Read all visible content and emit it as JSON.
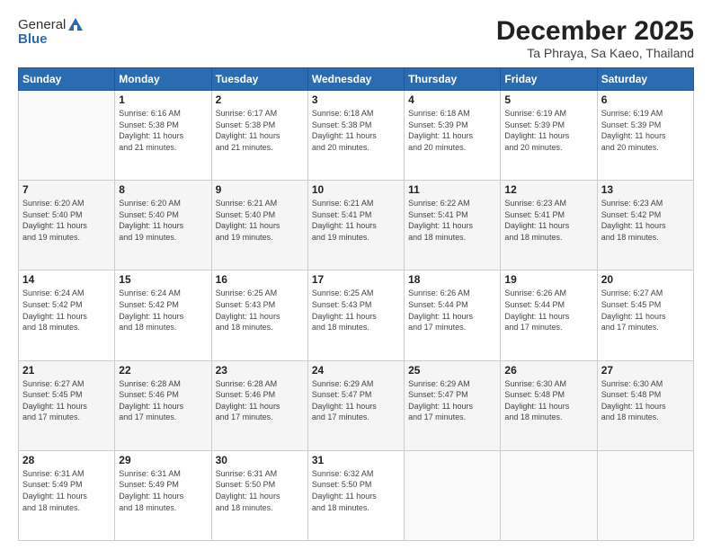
{
  "header": {
    "logo_general": "General",
    "logo_blue": "Blue",
    "month_title": "December 2025",
    "location": "Ta Phraya, Sa Kaeo, Thailand"
  },
  "weekdays": [
    "Sunday",
    "Monday",
    "Tuesday",
    "Wednesday",
    "Thursday",
    "Friday",
    "Saturday"
  ],
  "weeks": [
    [
      {
        "date": "",
        "sunrise": "",
        "sunset": "",
        "daylight": ""
      },
      {
        "date": "1",
        "sunrise": "Sunrise: 6:16 AM",
        "sunset": "Sunset: 5:38 PM",
        "daylight": "Daylight: 11 hours and 21 minutes."
      },
      {
        "date": "2",
        "sunrise": "Sunrise: 6:17 AM",
        "sunset": "Sunset: 5:38 PM",
        "daylight": "Daylight: 11 hours and 21 minutes."
      },
      {
        "date": "3",
        "sunrise": "Sunrise: 6:18 AM",
        "sunset": "Sunset: 5:38 PM",
        "daylight": "Daylight: 11 hours and 20 minutes."
      },
      {
        "date": "4",
        "sunrise": "Sunrise: 6:18 AM",
        "sunset": "Sunset: 5:39 PM",
        "daylight": "Daylight: 11 hours and 20 minutes."
      },
      {
        "date": "5",
        "sunrise": "Sunrise: 6:19 AM",
        "sunset": "Sunset: 5:39 PM",
        "daylight": "Daylight: 11 hours and 20 minutes."
      },
      {
        "date": "6",
        "sunrise": "Sunrise: 6:19 AM",
        "sunset": "Sunset: 5:39 PM",
        "daylight": "Daylight: 11 hours and 20 minutes."
      }
    ],
    [
      {
        "date": "7",
        "sunrise": "Sunrise: 6:20 AM",
        "sunset": "Sunset: 5:40 PM",
        "daylight": "Daylight: 11 hours and 19 minutes."
      },
      {
        "date": "8",
        "sunrise": "Sunrise: 6:20 AM",
        "sunset": "Sunset: 5:40 PM",
        "daylight": "Daylight: 11 hours and 19 minutes."
      },
      {
        "date": "9",
        "sunrise": "Sunrise: 6:21 AM",
        "sunset": "Sunset: 5:40 PM",
        "daylight": "Daylight: 11 hours and 19 minutes."
      },
      {
        "date": "10",
        "sunrise": "Sunrise: 6:21 AM",
        "sunset": "Sunset: 5:41 PM",
        "daylight": "Daylight: 11 hours and 19 minutes."
      },
      {
        "date": "11",
        "sunrise": "Sunrise: 6:22 AM",
        "sunset": "Sunset: 5:41 PM",
        "daylight": "Daylight: 11 hours and 18 minutes."
      },
      {
        "date": "12",
        "sunrise": "Sunrise: 6:23 AM",
        "sunset": "Sunset: 5:41 PM",
        "daylight": "Daylight: 11 hours and 18 minutes."
      },
      {
        "date": "13",
        "sunrise": "Sunrise: 6:23 AM",
        "sunset": "Sunset: 5:42 PM",
        "daylight": "Daylight: 11 hours and 18 minutes."
      }
    ],
    [
      {
        "date": "14",
        "sunrise": "Sunrise: 6:24 AM",
        "sunset": "Sunset: 5:42 PM",
        "daylight": "Daylight: 11 hours and 18 minutes."
      },
      {
        "date": "15",
        "sunrise": "Sunrise: 6:24 AM",
        "sunset": "Sunset: 5:42 PM",
        "daylight": "Daylight: 11 hours and 18 minutes."
      },
      {
        "date": "16",
        "sunrise": "Sunrise: 6:25 AM",
        "sunset": "Sunset: 5:43 PM",
        "daylight": "Daylight: 11 hours and 18 minutes."
      },
      {
        "date": "17",
        "sunrise": "Sunrise: 6:25 AM",
        "sunset": "Sunset: 5:43 PM",
        "daylight": "Daylight: 11 hours and 18 minutes."
      },
      {
        "date": "18",
        "sunrise": "Sunrise: 6:26 AM",
        "sunset": "Sunset: 5:44 PM",
        "daylight": "Daylight: 11 hours and 17 minutes."
      },
      {
        "date": "19",
        "sunrise": "Sunrise: 6:26 AM",
        "sunset": "Sunset: 5:44 PM",
        "daylight": "Daylight: 11 hours and 17 minutes."
      },
      {
        "date": "20",
        "sunrise": "Sunrise: 6:27 AM",
        "sunset": "Sunset: 5:45 PM",
        "daylight": "Daylight: 11 hours and 17 minutes."
      }
    ],
    [
      {
        "date": "21",
        "sunrise": "Sunrise: 6:27 AM",
        "sunset": "Sunset: 5:45 PM",
        "daylight": "Daylight: 11 hours and 17 minutes."
      },
      {
        "date": "22",
        "sunrise": "Sunrise: 6:28 AM",
        "sunset": "Sunset: 5:46 PM",
        "daylight": "Daylight: 11 hours and 17 minutes."
      },
      {
        "date": "23",
        "sunrise": "Sunrise: 6:28 AM",
        "sunset": "Sunset: 5:46 PM",
        "daylight": "Daylight: 11 hours and 17 minutes."
      },
      {
        "date": "24",
        "sunrise": "Sunrise: 6:29 AM",
        "sunset": "Sunset: 5:47 PM",
        "daylight": "Daylight: 11 hours and 17 minutes."
      },
      {
        "date": "25",
        "sunrise": "Sunrise: 6:29 AM",
        "sunset": "Sunset: 5:47 PM",
        "daylight": "Daylight: 11 hours and 17 minutes."
      },
      {
        "date": "26",
        "sunrise": "Sunrise: 6:30 AM",
        "sunset": "Sunset: 5:48 PM",
        "daylight": "Daylight: 11 hours and 18 minutes."
      },
      {
        "date": "27",
        "sunrise": "Sunrise: 6:30 AM",
        "sunset": "Sunset: 5:48 PM",
        "daylight": "Daylight: 11 hours and 18 minutes."
      }
    ],
    [
      {
        "date": "28",
        "sunrise": "Sunrise: 6:31 AM",
        "sunset": "Sunset: 5:49 PM",
        "daylight": "Daylight: 11 hours and 18 minutes."
      },
      {
        "date": "29",
        "sunrise": "Sunrise: 6:31 AM",
        "sunset": "Sunset: 5:49 PM",
        "daylight": "Daylight: 11 hours and 18 minutes."
      },
      {
        "date": "30",
        "sunrise": "Sunrise: 6:31 AM",
        "sunset": "Sunset: 5:50 PM",
        "daylight": "Daylight: 11 hours and 18 minutes."
      },
      {
        "date": "31",
        "sunrise": "Sunrise: 6:32 AM",
        "sunset": "Sunset: 5:50 PM",
        "daylight": "Daylight: 11 hours and 18 minutes."
      },
      {
        "date": "",
        "sunrise": "",
        "sunset": "",
        "daylight": ""
      },
      {
        "date": "",
        "sunrise": "",
        "sunset": "",
        "daylight": ""
      },
      {
        "date": "",
        "sunrise": "",
        "sunset": "",
        "daylight": ""
      }
    ]
  ]
}
